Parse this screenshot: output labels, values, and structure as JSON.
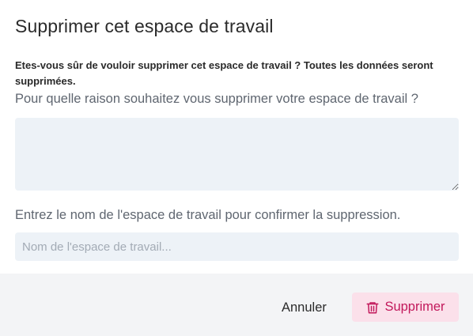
{
  "dialog": {
    "title": "Supprimer cet espace de travail",
    "warning": "Etes-vous sûr de vouloir supprimer cet espace de travail ? Toutes les données seront supprimées.",
    "reason_label": "Pour quelle raison souhaitez vous supprimer votre espace de travail ?",
    "reason_value": "",
    "confirm_label": "Entrez le nom de l'espace de travail pour confirmer la suppression.",
    "name_placeholder": "Nom de l'espace de travail...",
    "name_value": ""
  },
  "footer": {
    "cancel_label": "Annuler",
    "delete_label": "Supprimer",
    "delete_icon": "trash-icon"
  },
  "colors": {
    "delete_text": "#c2185b",
    "delete_bg": "#fbe0ea",
    "input_bg": "#edf2f7",
    "footer_bg": "#f3f4f6"
  }
}
